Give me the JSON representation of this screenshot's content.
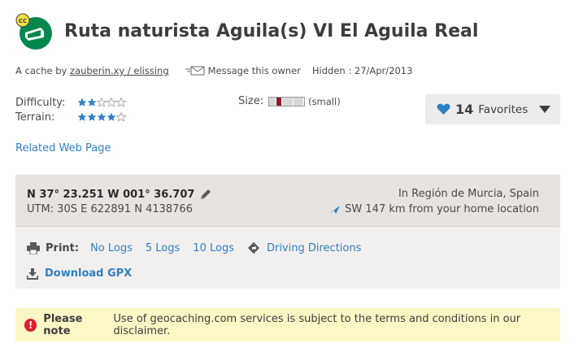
{
  "header": {
    "title": "Ruta naturista Aguila(s) VI El Aguila Real",
    "icon_badge": "CC"
  },
  "meta": {
    "by_prefix": "A cache by",
    "owner": "zauberin.xy / elissing",
    "message_owner": "Message this owner",
    "hidden": "Hidden : 27/Apr/2013"
  },
  "ratings": {
    "difficulty_label": "Difficulty:",
    "difficulty": 2,
    "terrain_label": "Terrain:",
    "terrain": 4,
    "max": 5
  },
  "size": {
    "label": "Size:",
    "value": "(small)"
  },
  "favorites": {
    "count": "14",
    "label": "Favorites"
  },
  "related_link": "Related Web Page",
  "coordinates": {
    "main": "N 37° 23.251 W 001° 36.707",
    "utm": "UTM: 30S E 622891 N 4138766",
    "location": "In Región de Murcia, Spain",
    "distance": "SW 147 km from your home location"
  },
  "print": {
    "label": "Print:",
    "options": [
      "No Logs",
      "5 Logs",
      "10 Logs"
    ],
    "driving": "Driving Directions"
  },
  "download_gpx": "Download GPX",
  "note": {
    "bold": "Please note",
    "text": "Use of geocaching.com services is subject to the terms and conditions in our disclaimer."
  },
  "colors": {
    "green": "#02874d",
    "blue_link": "#2f7fc5",
    "star_fill": "#2f7fc5",
    "alert_red": "#e01e2b"
  }
}
